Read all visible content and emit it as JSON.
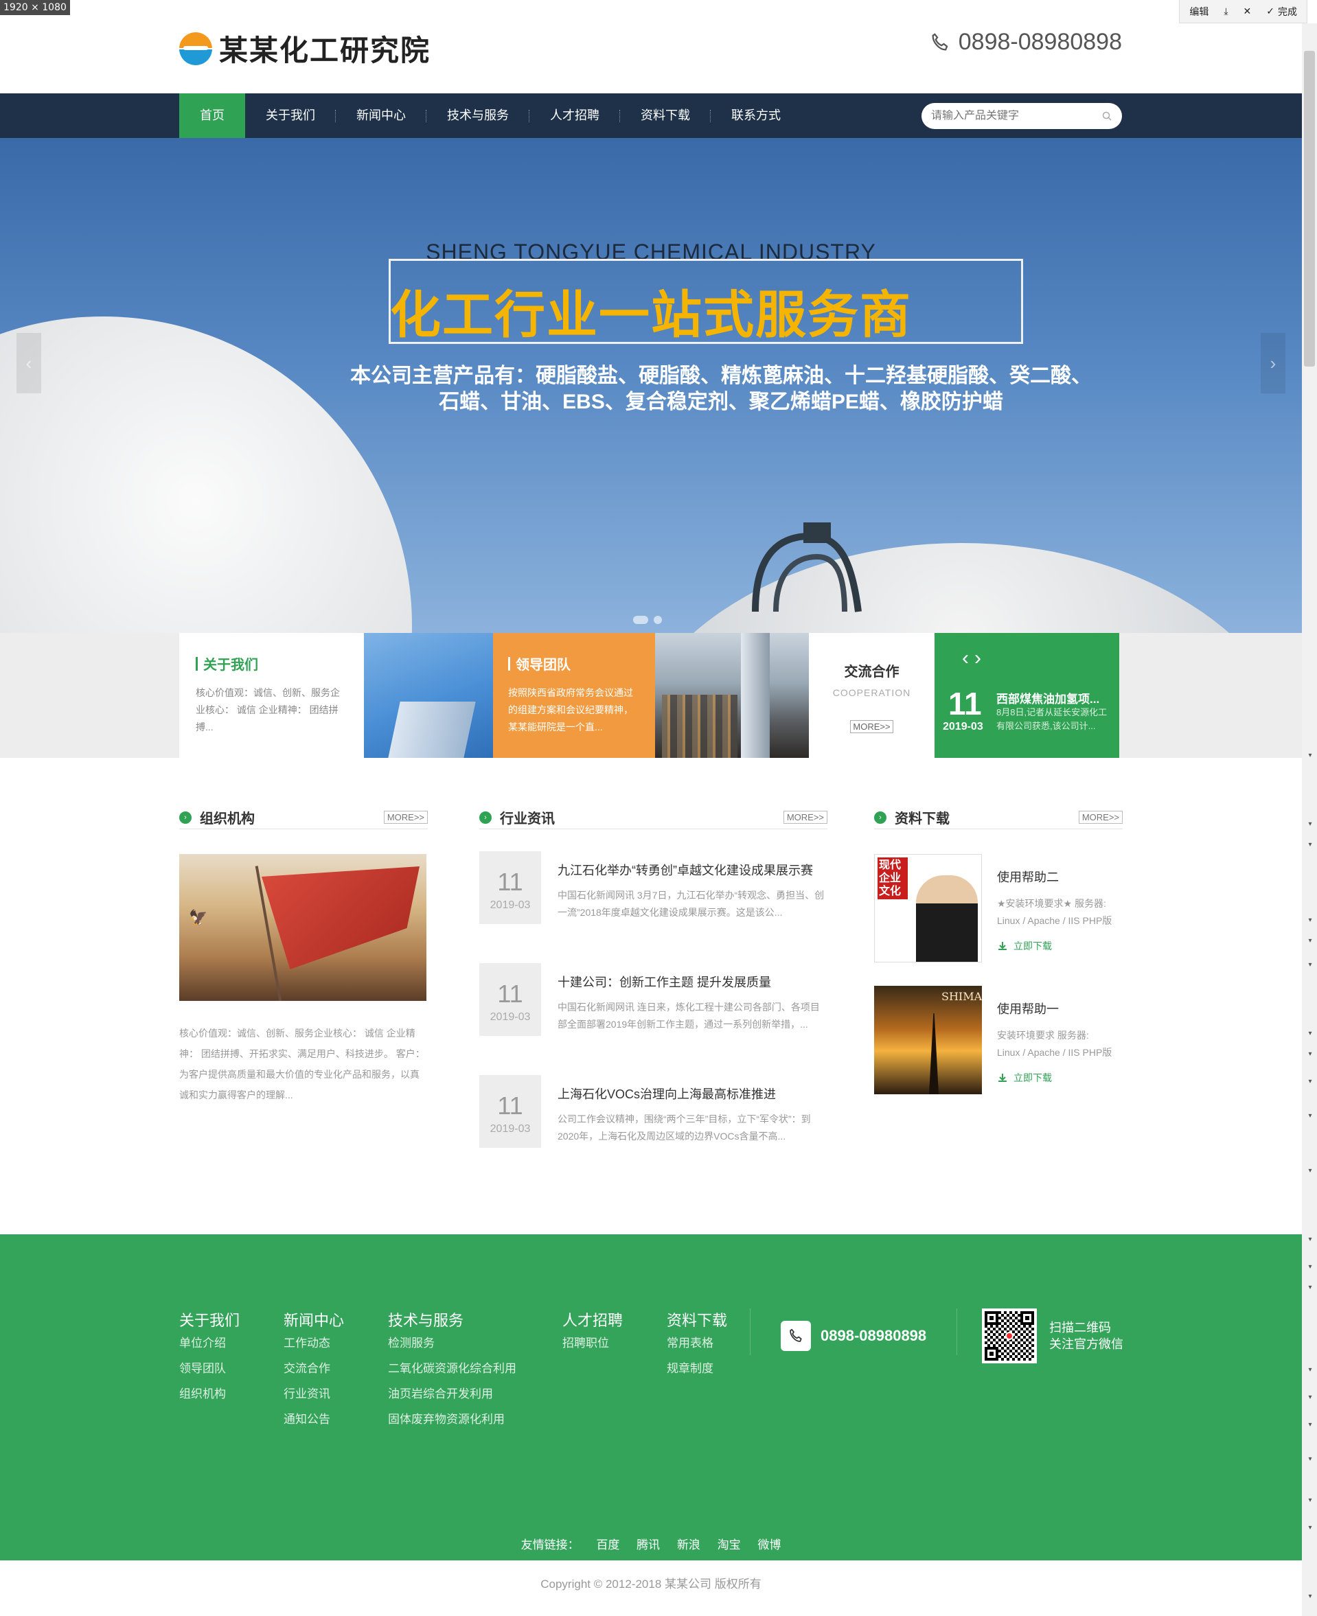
{
  "screenshot": {
    "size_label": "1920 × 1080",
    "tools": {
      "edit": "编辑",
      "done": "完成"
    }
  },
  "header": {
    "logo_text": "某某化工研究院",
    "phone": "0898-08980898"
  },
  "nav": {
    "items": [
      {
        "label": "首页"
      },
      {
        "label": "关于我们"
      },
      {
        "label": "新闻中心"
      },
      {
        "label": "技术与服务"
      },
      {
        "label": "人才招聘"
      },
      {
        "label": "资料下载"
      },
      {
        "label": "联系方式"
      }
    ],
    "active_index": 0,
    "search_placeholder": "请输入产品关键字"
  },
  "banner": {
    "subtitle": "SHENG TONGYUE CHEMICAL INDUSTRY",
    "title": "化工行业一站式服务商",
    "desc_line1": "本公司主营产品有：硬脂酸盐、硬脂酸、精炼蓖麻油、十二羟基硬脂酸、癸二酸、",
    "desc_line2": "石蜡、甘油、EBS、复合稳定剂、聚乙烯蜡PE蜡、橡胶防护蜡",
    "slide_count": 2,
    "active_slide": 0
  },
  "promo": {
    "about": {
      "title": "关于我们",
      "text": "核心价值观：诚信、创新、服务企业核心： 诚信 企业精神： 团结拼搏..."
    },
    "team": {
      "title": "领导团队",
      "text": "按照陕西省政府常务会议通过的组建方案和会议纪要精神，某某能研院是一个直..."
    },
    "coop": {
      "title": "交流合作",
      "subtitle": "COOPERATION",
      "more": "MORE>>"
    },
    "news": {
      "day": "11",
      "ym": "2019-03",
      "title": "西部煤焦油加氢项...",
      "text": "8月8日,记者从延长安源化工有限公司获悉,该公司计..."
    }
  },
  "sections": {
    "org": {
      "title": "组织机构",
      "more": "MORE>>",
      "text": "核心价值观：诚信、创新、服务企业核心： 诚信 企业精神： 团结拼搏、开拓求实、满足用户、科技进步。 客户：为客户提供高质量和最大价值的专业化产品和服务，以真诚和实力赢得客户的理解..."
    },
    "industry_news": {
      "title": "行业资讯",
      "more": "MORE>>",
      "items": [
        {
          "day": "11",
          "ym": "2019-03",
          "title": "九江石化举办“转勇创”卓越文化建设成果展示赛",
          "desc": "中国石化新闻网讯 3月7日，九江石化举办“转观念、勇担当、创一流”2018年度卓越文化建设成果展示赛。这是该公..."
        },
        {
          "day": "11",
          "ym": "2019-03",
          "title": "十建公司：创新工作主题 提升发展质量",
          "desc": "中国石化新闻网讯 连日来，炼化工程十建公司各部门、各项目部全面部署2019年创新工作主题，通过一系列创新举措，..."
        },
        {
          "day": "11",
          "ym": "2019-03",
          "title": "上海石化VOCs治理向上海最高标准推进",
          "desc": "公司工作会议精神，围绕“两个三年”目标，立下“军令状”：到2020年，上海石化及周边区域的边界VOCs含量不高..."
        }
      ]
    },
    "downloads": {
      "title": "资料下载",
      "more": "MORE>>",
      "items": [
        {
          "title": "使用帮助二",
          "desc_line1": "★安装环境要求★ 服务器:",
          "desc_line2": "Linux / Apache / IIS PHP版",
          "button": "立即下载",
          "cover_text": "现代企业文化"
        },
        {
          "title": "使用帮助一",
          "desc_line1": "安装环境要求 服务器:",
          "desc_line2": "Linux / Apache / IIS PHP版",
          "button": "立即下载",
          "cover_text": "SHIMAO"
        }
      ]
    }
  },
  "footer": {
    "columns": [
      {
        "title": "关于我们",
        "links": [
          "单位介绍",
          "领导团队",
          "组织机构"
        ]
      },
      {
        "title": "新闻中心",
        "links": [
          "工作动态",
          "交流合作",
          "行业资讯",
          "通知公告"
        ]
      },
      {
        "title": "技术与服务",
        "links": [
          "检测服务",
          "二氧化碳资源化综合利用",
          "油页岩综合开发利用",
          "固体废弃物资源化利用"
        ]
      },
      {
        "title": "人才招聘",
        "links": [
          "招聘职位"
        ]
      },
      {
        "title": "资料下载",
        "links": [
          "常用表格",
          "规章制度"
        ]
      }
    ],
    "phone": "0898-08980898",
    "qr_line1": "扫描二维码",
    "qr_line2": "关注官方微信",
    "friend_links_label": "友情链接：",
    "friend_links": [
      "百度",
      "腾讯",
      "新浪",
      "淘宝",
      "微博"
    ],
    "copyright": "Copyright © 2012-2018 某某公司 版权所有"
  },
  "colors": {
    "nav_bg": "#1e3148",
    "accent_green": "#2fa254",
    "footer_green": "#33a45a",
    "orange": "#f29a3f",
    "banner_title": "#f5b400"
  }
}
